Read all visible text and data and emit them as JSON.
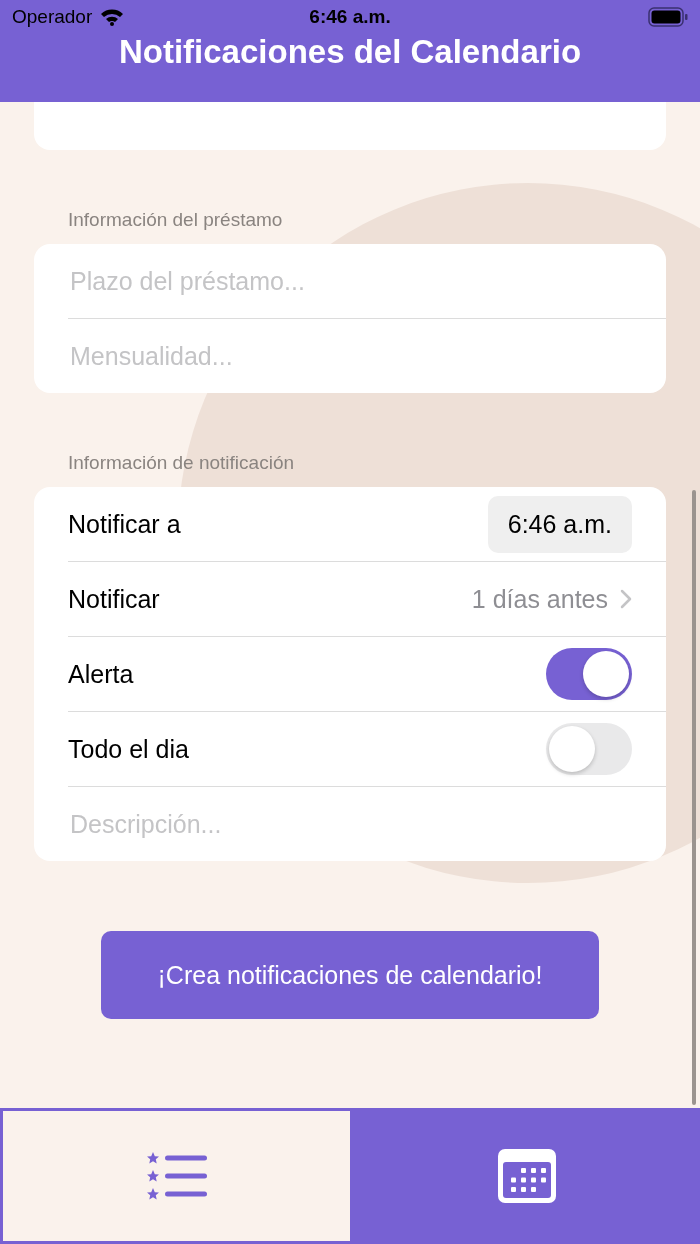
{
  "status_bar": {
    "carrier": "Operador",
    "time": "6:46 a.m."
  },
  "header": {
    "title": "Notificaciones del Calendario"
  },
  "sections": [
    {
      "title": "Información del préstamo",
      "rows": [
        {
          "kind": "field",
          "placeholder": "Plazo del préstamo..."
        },
        {
          "kind": "field",
          "placeholder": "Mensualidad..."
        }
      ]
    },
    {
      "title": "Información de notificación",
      "rows": [
        {
          "kind": "time",
          "label": "Notificar a",
          "value": "6:46 a.m."
        },
        {
          "kind": "picker",
          "label": "Notificar",
          "value": "1 días antes"
        },
        {
          "kind": "toggle",
          "label": "Alerta",
          "on": true
        },
        {
          "kind": "toggle",
          "label": "Todo el dia",
          "on": false
        },
        {
          "kind": "field",
          "placeholder": "Descripción..."
        }
      ]
    }
  ],
  "create_button": "¡Crea notificaciones de calendario!",
  "tabs": [
    {
      "kind": "list",
      "selected": true
    },
    {
      "kind": "calendar",
      "selected": false
    }
  ]
}
